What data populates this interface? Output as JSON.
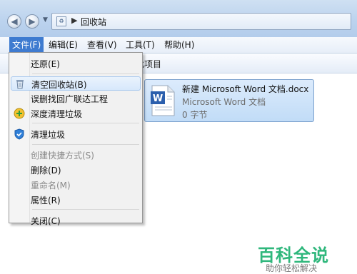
{
  "address": {
    "path": "回收站",
    "breadcrumb_arrow": "▶"
  },
  "menubar": {
    "items": [
      {
        "label": "文件(F)"
      },
      {
        "label": "编辑(E)"
      },
      {
        "label": "查看(V)"
      },
      {
        "label": "工具(T)"
      },
      {
        "label": "帮助(H)"
      }
    ]
  },
  "toolbar": {
    "partial_label": "此项目"
  },
  "file": {
    "name": "新建 Microsoft Word 文档.docx",
    "type": "Microsoft Word 文档",
    "size": "0 字节",
    "icon": "word-document-icon"
  },
  "file_menu": {
    "items": [
      {
        "label": "还原(E)",
        "enabled": true
      },
      {
        "label": "清空回收站(B)",
        "enabled": true,
        "icon": "recycle-bin-icon"
      },
      {
        "label": "误删找回广联达工程",
        "enabled": true
      },
      {
        "label": "深度清理垃圾",
        "enabled": true,
        "icon": "cleanup-plus-icon"
      },
      {
        "label": "清理垃圾",
        "enabled": true,
        "icon": "shield-icon"
      },
      {
        "label": "创建快捷方式(S)",
        "enabled": false
      },
      {
        "label": "删除(D)",
        "enabled": true
      },
      {
        "label": "重命名(M)",
        "enabled": false
      },
      {
        "label": "属性(R)",
        "enabled": true
      },
      {
        "label": "关闭(C)",
        "enabled": true
      }
    ]
  },
  "watermark": {
    "title": "百科全说",
    "subtitle": "助你轻松解决"
  },
  "colors": {
    "menu_active": "#3e7bd0",
    "watermark": "#2fb77c",
    "selection": "#c1dcf7"
  }
}
